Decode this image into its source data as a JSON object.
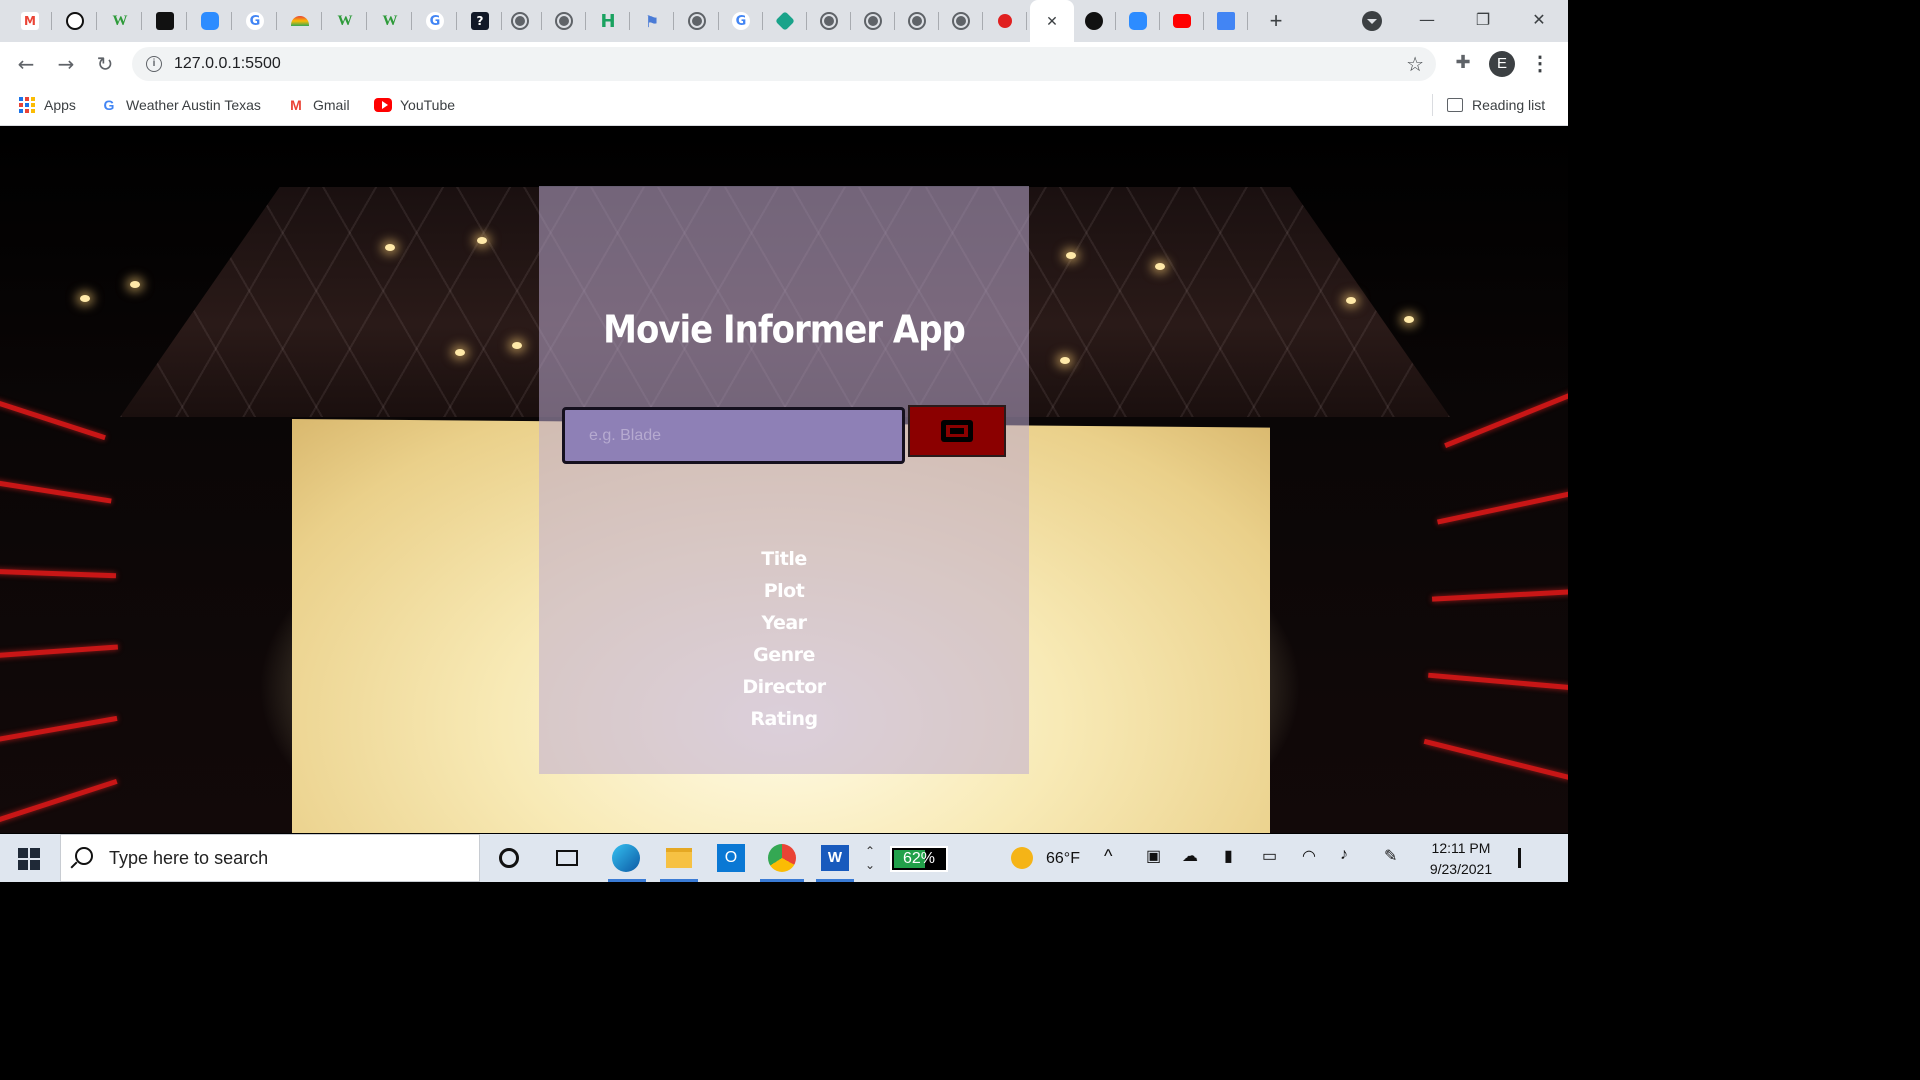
{
  "browser": {
    "address_bar": {
      "url": "127.0.0.1:5500"
    },
    "profile_initial": "E",
    "bookmarks": [
      {
        "label": "Apps",
        "icon": "apps-grid-icon"
      },
      {
        "label": "Weather Austin Texas",
        "icon": "google-icon"
      },
      {
        "label": "Gmail",
        "icon": "gmail-icon"
      },
      {
        "label": "YouTube",
        "icon": "youtube-icon"
      }
    ],
    "reading_list_label": "Reading list",
    "new_tab_symbol": "+",
    "window_controls": {
      "minimize": "—",
      "maximize": "❐",
      "close": "✕"
    }
  },
  "page": {
    "app_title": "Movie Informer App",
    "search": {
      "placeholder": "e.g. Blade",
      "value": ""
    },
    "search_button_icon": "ticket-icon",
    "info_fields": [
      "Title",
      "Plot",
      "Year",
      "Genre",
      "Director",
      "Rating"
    ],
    "colors": {
      "card_bg": "#bfacd2",
      "input_bg": "#8e80b6",
      "button_bg": "#8b0000"
    }
  },
  "taskbar": {
    "search_placeholder": "Type here to search",
    "battery_percent": "62%",
    "battery_level": 0.62,
    "weather_temp": "66°F",
    "time": "12:11 PM",
    "date": "9/23/2021"
  }
}
